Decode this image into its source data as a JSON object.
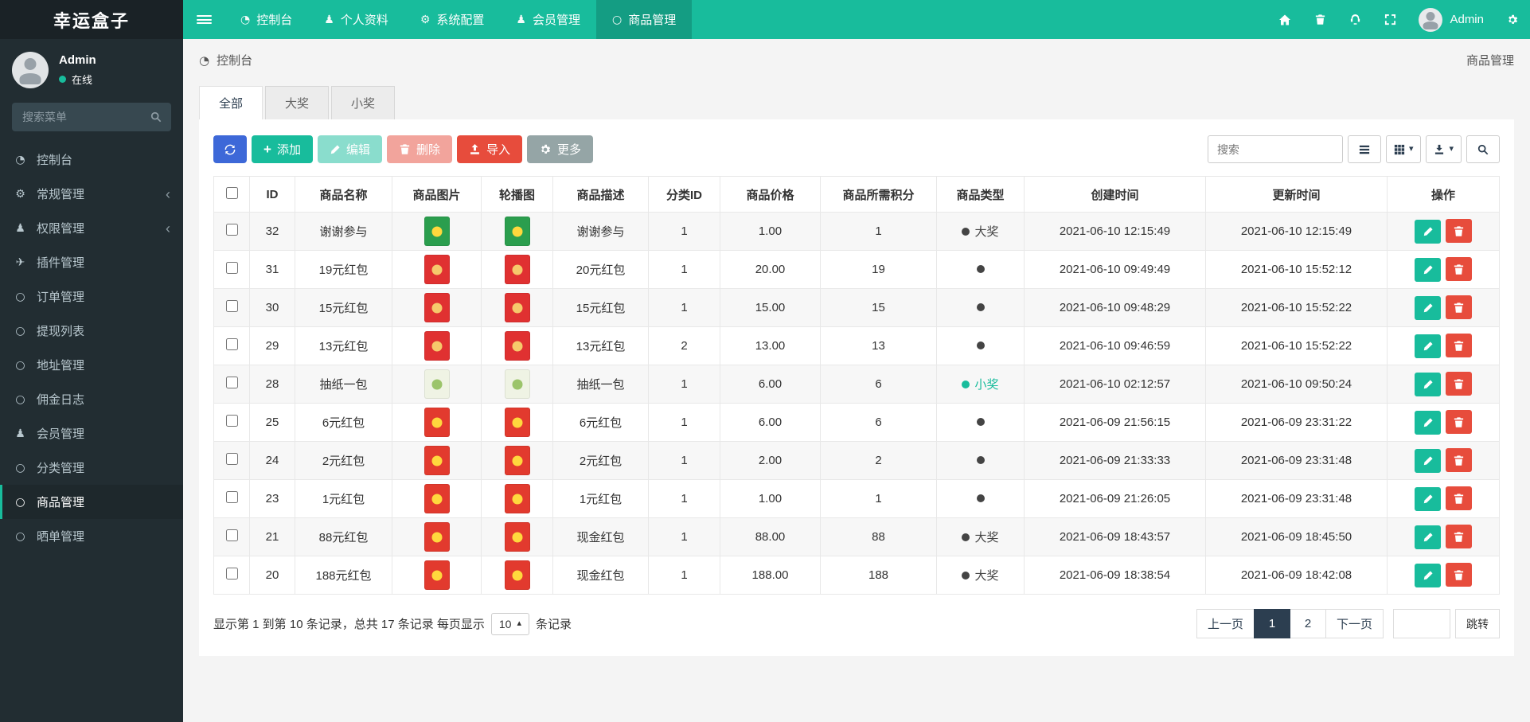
{
  "brand": "幸运盒子",
  "topnav": {
    "items": [
      {
        "key": "dashboard",
        "icon": "dashboard",
        "label": "控制台",
        "active": false
      },
      {
        "key": "profile",
        "icon": "user",
        "label": "个人资料",
        "active": false
      },
      {
        "key": "system-config",
        "icon": "gear",
        "label": "系统配置",
        "active": false
      },
      {
        "key": "member-manage",
        "icon": "users",
        "label": "会员管理",
        "active": false
      },
      {
        "key": "goods-manage",
        "icon": "circle",
        "label": "商品管理",
        "active": true
      }
    ],
    "user_name": "Admin"
  },
  "sidebar": {
    "user_name": "Admin",
    "user_status": "在线",
    "search_placeholder": "搜索菜单",
    "items": [
      {
        "key": "dashboard",
        "icon": "dashboard",
        "label": "控制台",
        "active": false,
        "chevron": false
      },
      {
        "key": "general",
        "icon": "gear",
        "label": "常规管理",
        "active": false,
        "chevron": true
      },
      {
        "key": "auth",
        "icon": "users",
        "label": "权限管理",
        "active": false,
        "chevron": true
      },
      {
        "key": "addon",
        "icon": "plane",
        "label": "插件管理",
        "active": false,
        "chevron": false
      },
      {
        "key": "order",
        "icon": "circle",
        "label": "订单管理",
        "active": false,
        "chevron": false
      },
      {
        "key": "withdraw",
        "icon": "circle",
        "label": "提现列表",
        "active": false,
        "chevron": false
      },
      {
        "key": "address",
        "icon": "circle",
        "label": "地址管理",
        "active": false,
        "chevron": false
      },
      {
        "key": "commission",
        "icon": "circle",
        "label": "佣金日志",
        "active": false,
        "chevron": false
      },
      {
        "key": "member",
        "icon": "user",
        "label": "会员管理",
        "active": false,
        "chevron": false
      },
      {
        "key": "category",
        "icon": "circle",
        "label": "分类管理",
        "active": false,
        "chevron": false
      },
      {
        "key": "goods",
        "icon": "circle",
        "label": "商品管理",
        "active": true,
        "chevron": false
      },
      {
        "key": "share",
        "icon": "circle",
        "label": "晒单管理",
        "active": false,
        "chevron": false
      }
    ]
  },
  "breadcrumb": {
    "left": "控制台",
    "right": "商品管理"
  },
  "tabs": [
    {
      "key": "all",
      "label": "全部",
      "active": true
    },
    {
      "key": "big-prize",
      "label": "大奖",
      "active": false
    },
    {
      "key": "small-prize",
      "label": "小奖",
      "active": false
    }
  ],
  "toolbar": {
    "add": "添加",
    "edit": "编辑",
    "delete": "删除",
    "import": "导入",
    "more": "更多",
    "search_placeholder": "搜索"
  },
  "table": {
    "columns": [
      "ID",
      "商品名称",
      "商品图片",
      "轮播图",
      "商品描述",
      "分类ID",
      "商品价格",
      "商品所需积分",
      "商品类型",
      "创建时间",
      "更新时间",
      "操作"
    ],
    "rows": [
      {
        "id": "32",
        "name": "谢谢参与",
        "thumb_bg": "#2b9e4e",
        "thumb_accent": "#ffd83d",
        "desc": "谢谢参与",
        "category_id": "1",
        "price": "1.00",
        "points": "1",
        "type_label": "大奖",
        "type_color": "#444444",
        "created_at": "2021-06-10 12:15:49",
        "updated_at": "2021-06-10 12:15:49"
      },
      {
        "id": "31",
        "name": "19元红包",
        "thumb_bg": "#e03131",
        "thumb_accent": "#f6c96b",
        "desc": "20元红包",
        "category_id": "1",
        "price": "20.00",
        "points": "19",
        "type_label": "",
        "type_color": "#444444",
        "created_at": "2021-06-10 09:49:49",
        "updated_at": "2021-06-10 15:52:12"
      },
      {
        "id": "30",
        "name": "15元红包",
        "thumb_bg": "#e03131",
        "thumb_accent": "#f6c96b",
        "desc": "15元红包",
        "category_id": "1",
        "price": "15.00",
        "points": "15",
        "type_label": "",
        "type_color": "#444444",
        "created_at": "2021-06-10 09:48:29",
        "updated_at": "2021-06-10 15:52:22"
      },
      {
        "id": "29",
        "name": "13元红包",
        "thumb_bg": "#e03131",
        "thumb_accent": "#f6c96b",
        "desc": "13元红包",
        "category_id": "2",
        "price": "13.00",
        "points": "13",
        "type_label": "",
        "type_color": "#444444",
        "created_at": "2021-06-10 09:46:59",
        "updated_at": "2021-06-10 15:52:22"
      },
      {
        "id": "28",
        "name": "抽纸一包",
        "thumb_bg": "#eff3e4",
        "thumb_accent": "#9bc46a",
        "desc": "抽纸一包",
        "category_id": "1",
        "price": "6.00",
        "points": "6",
        "type_label": "小奖",
        "type_color": "#18bc9c",
        "created_at": "2021-06-10 02:12:57",
        "updated_at": "2021-06-10 09:50:24"
      },
      {
        "id": "25",
        "name": "6元红包",
        "thumb_bg": "#e23a2e",
        "thumb_accent": "#ffd83d",
        "desc": "6元红包",
        "category_id": "1",
        "price": "6.00",
        "points": "6",
        "type_label": "",
        "type_color": "#444444",
        "created_at": "2021-06-09 21:56:15",
        "updated_at": "2021-06-09 23:31:22"
      },
      {
        "id": "24",
        "name": "2元红包",
        "thumb_bg": "#e23a2e",
        "thumb_accent": "#ffd83d",
        "desc": "2元红包",
        "category_id": "1",
        "price": "2.00",
        "points": "2",
        "type_label": "",
        "type_color": "#444444",
        "created_at": "2021-06-09 21:33:33",
        "updated_at": "2021-06-09 23:31:48"
      },
      {
        "id": "23",
        "name": "1元红包",
        "thumb_bg": "#e23a2e",
        "thumb_accent": "#ffd83d",
        "desc": "1元红包",
        "category_id": "1",
        "price": "1.00",
        "points": "1",
        "type_label": "",
        "type_color": "#444444",
        "created_at": "2021-06-09 21:26:05",
        "updated_at": "2021-06-09 23:31:48"
      },
      {
        "id": "21",
        "name": "88元红包",
        "thumb_bg": "#e23a2e",
        "thumb_accent": "#ffd83d",
        "desc": "现金红包",
        "category_id": "1",
        "price": "88.00",
        "points": "88",
        "type_label": "大奖",
        "type_color": "#444444",
        "created_at": "2021-06-09 18:43:57",
        "updated_at": "2021-06-09 18:45:50"
      },
      {
        "id": "20",
        "name": "188元红包",
        "thumb_bg": "#e23a2e",
        "thumb_accent": "#ffd83d",
        "desc": "现金红包",
        "category_id": "1",
        "price": "188.00",
        "points": "188",
        "type_label": "大奖",
        "type_color": "#444444",
        "created_at": "2021-06-09 18:38:54",
        "updated_at": "2021-06-09 18:42:08"
      }
    ]
  },
  "footer": {
    "summary_prefix": "显示第 1 到第 10 条记录，总共 17 条记录 每页显示",
    "page_size": "10",
    "summary_suffix": "条记录",
    "pages": [
      {
        "key": "prev",
        "label": "上一页",
        "active": false
      },
      {
        "key": "page-1",
        "label": "1",
        "active": true
      },
      {
        "key": "page-2",
        "label": "2",
        "active": false
      },
      {
        "key": "next",
        "label": "下一页",
        "active": false
      }
    ],
    "jump_label": "跳转"
  },
  "colors": {
    "accent": "#18bc9c",
    "danger": "#e74c3c",
    "primary_dark": "#2c3e50",
    "refresh_blue": "#3d68d8"
  }
}
